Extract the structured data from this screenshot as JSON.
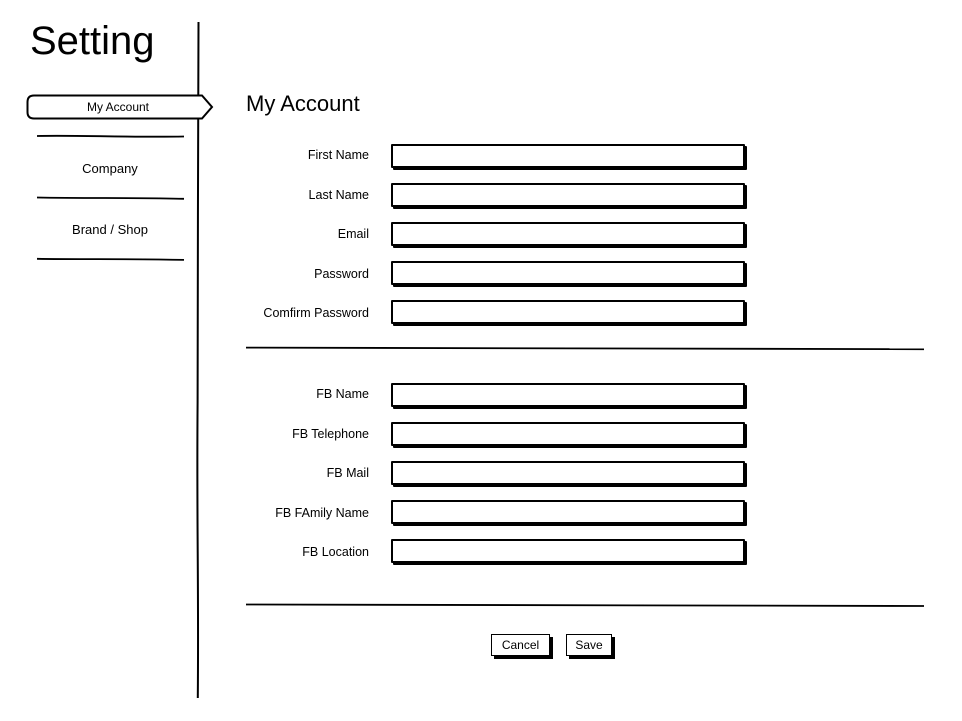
{
  "app": {
    "title": "Setting"
  },
  "sidebar": {
    "active_item": "My Account",
    "items": [
      {
        "label": "My Account"
      },
      {
        "label": "Company"
      },
      {
        "label": "Brand / Shop"
      }
    ]
  },
  "main": {
    "section_title": "My Account",
    "account_fields": [
      {
        "label": "First Name",
        "value": ""
      },
      {
        "label": "Last Name",
        "value": ""
      },
      {
        "label": "Email",
        "value": ""
      },
      {
        "label": "Password",
        "value": ""
      },
      {
        "label": "Comfirm Password",
        "value": ""
      }
    ],
    "fb_fields": [
      {
        "label": "FB Name",
        "value": ""
      },
      {
        "label": "FB Telephone",
        "value": ""
      },
      {
        "label": "FB Mail",
        "value": ""
      },
      {
        "label": "FB FAmily Name",
        "value": ""
      },
      {
        "label": "FB Location",
        "value": ""
      }
    ]
  },
  "actions": {
    "cancel_label": "Cancel",
    "save_label": "Save"
  }
}
